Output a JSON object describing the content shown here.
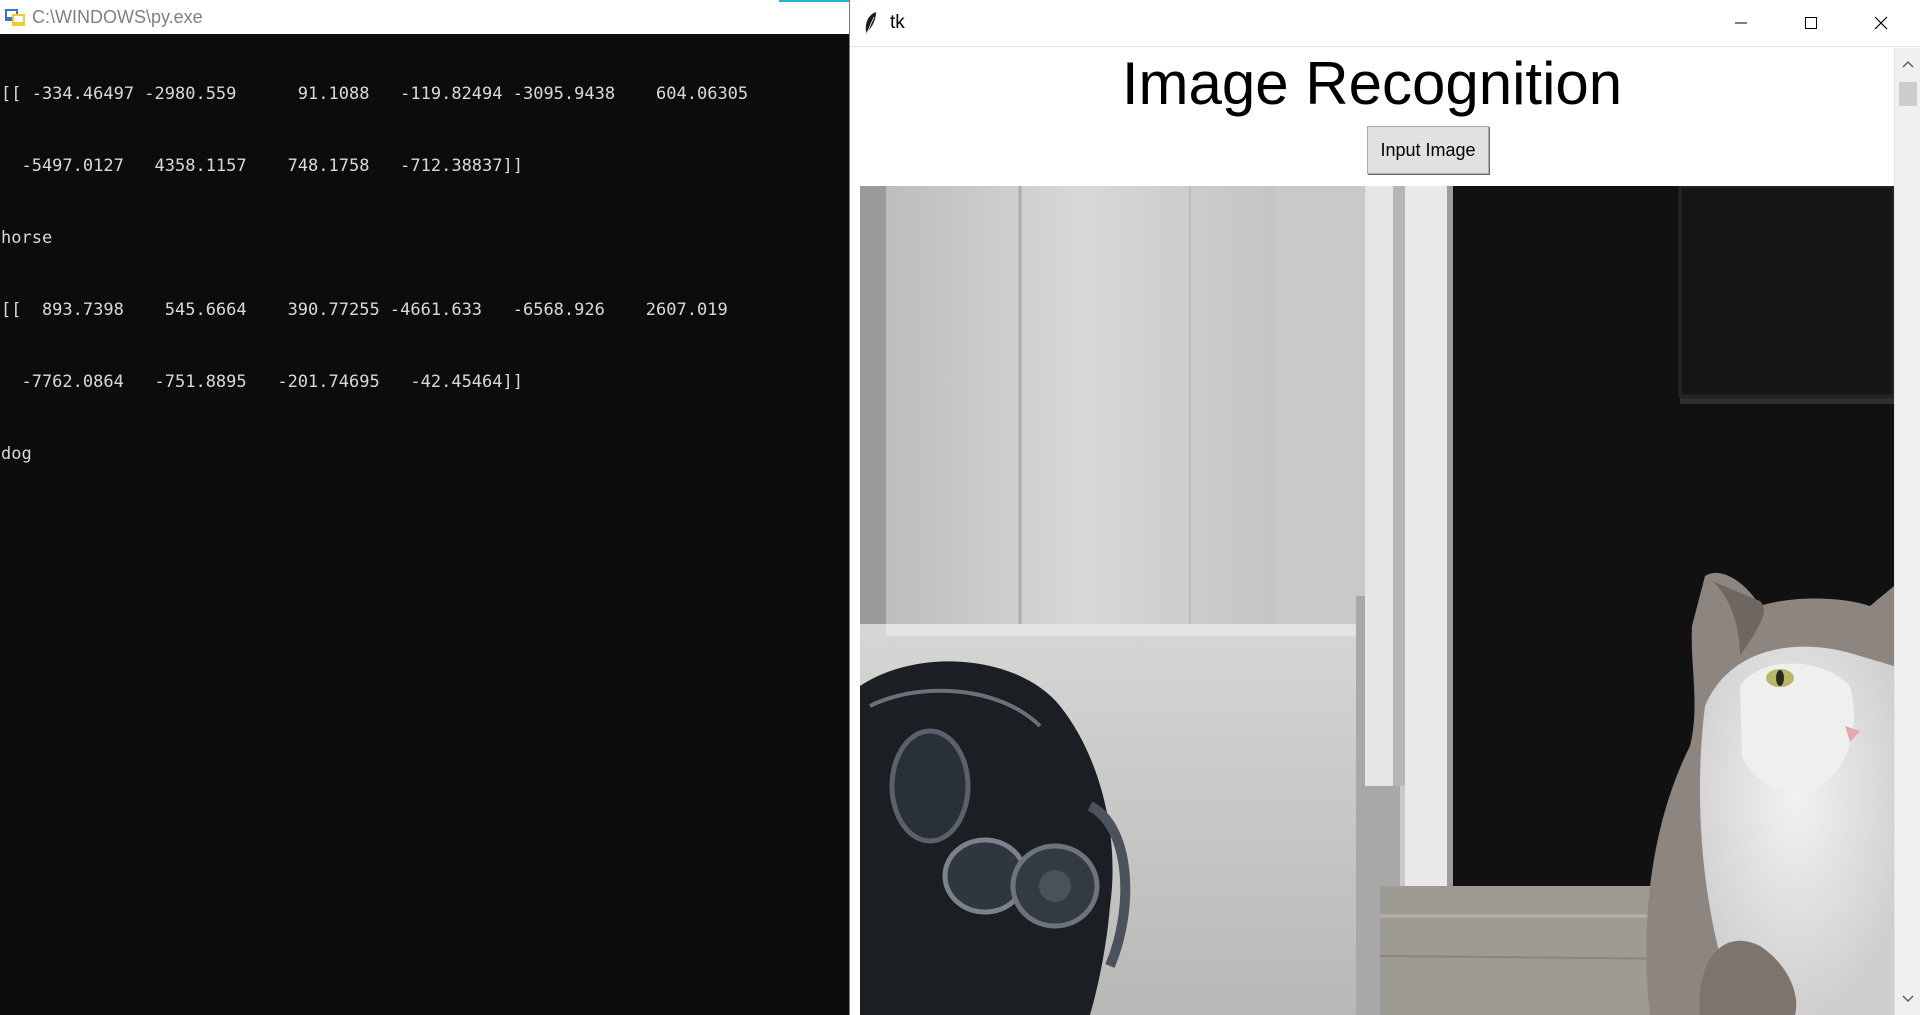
{
  "console": {
    "title": "C:\\WINDOWS\\py.exe",
    "lines": [
      "[[ -334.46497 -2980.559      91.1088   -119.82494 -3095.9438    604.06305",
      "  -5497.0127   4358.1157    748.1758   -712.38837]]",
      "horse",
      "[[  893.7398    545.6664    390.77255 -4661.633   -6568.926    2607.019",
      "  -7762.0864   -751.8895   -201.74695   -42.45464]]",
      "dog"
    ]
  },
  "tk_window": {
    "title": "tk",
    "heading": "Image Recognition",
    "input_button_label": "Input Image",
    "image_description_icon": "cat-photo"
  },
  "colors": {
    "console_bg": "#0c0c0c",
    "console_text": "#d9d9d9",
    "title_accent": "#1fb5c9"
  }
}
